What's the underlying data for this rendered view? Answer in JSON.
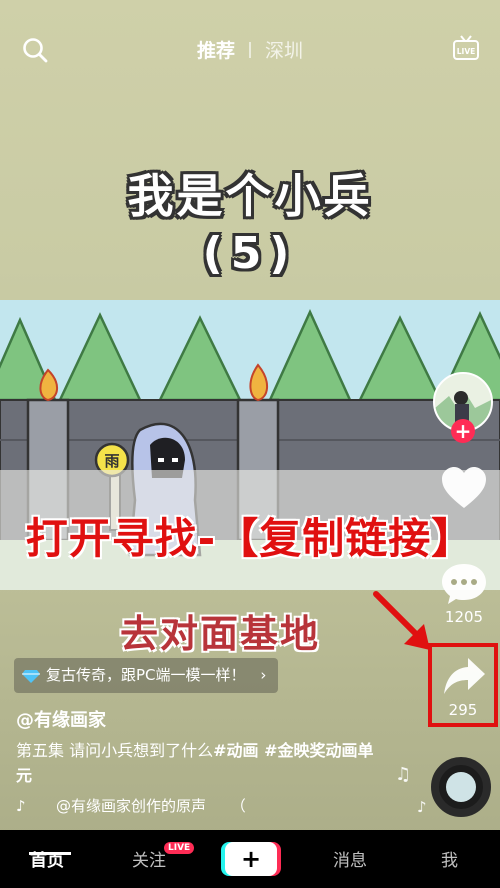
{
  "header": {
    "tab_recommend": "推荐",
    "tab_location": "深圳"
  },
  "video": {
    "title_line1": "我是个小兵",
    "title_line2": "(5)",
    "overlay_banner": "打开寻找-【复制链接】",
    "overlay_subtitle": "去对面基地",
    "coin_glyph": "雨"
  },
  "rail": {
    "comment_count": "1205",
    "share_count": "295"
  },
  "info": {
    "promo_text": "复古传奇，跟PC端一模一样！",
    "promo_arrow": "›",
    "username": "@有缘画家",
    "caption_plain": "第五集 请问小兵想到了什么",
    "caption_tags": "#动画 #金映奖动画单元",
    "music_text": "@有缘画家创作的原声",
    "music_trailing": "（"
  },
  "tabbar": {
    "home": "首页",
    "follow": "关注",
    "live_badge": "LIVE",
    "plus": "+",
    "messages": "消息",
    "me": "我"
  },
  "colors": {
    "accent_red": "#fe2c55",
    "highlight_red": "#e01010",
    "accent_cyan": "#25f4ee"
  },
  "icons": [
    "search-icon",
    "live-icon",
    "heart-icon",
    "comment-icon",
    "share-icon",
    "music-note-icon",
    "diamond-icon",
    "tiktok-icon"
  ]
}
